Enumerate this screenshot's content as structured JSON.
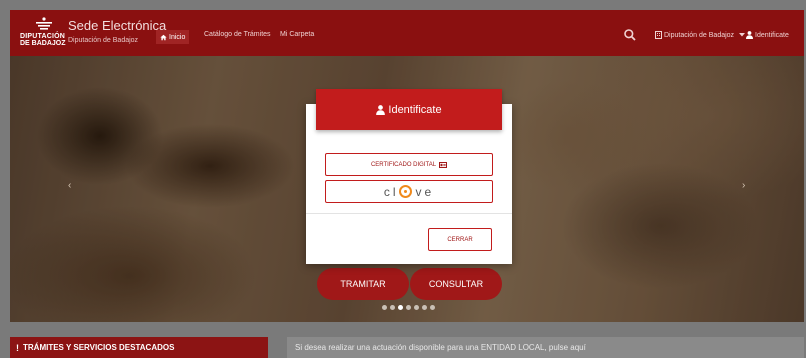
{
  "navbar": {
    "logo_line1": "DIPUTACIÓN",
    "logo_line2": "DE BADAJOZ",
    "site_title": "Sede Electrónica",
    "site_subtitle": "Diputación de Badajoz",
    "links": [
      {
        "label": "Inicio",
        "icon": "home-icon",
        "active": true
      },
      {
        "label": "Catálogo de Trámites"
      },
      {
        "label": "Mi Carpeta"
      }
    ],
    "search_icon": "search-icon",
    "org_dropdown": "Diputación de Badajoz",
    "identify": "Identificate"
  },
  "hero": {
    "prev_arrow": "‹",
    "next_arrow": "›",
    "tramitar": "TRAMITAR",
    "consultar": "CONSULTAR",
    "dots_count": 7,
    "active_dot": 2
  },
  "modal": {
    "title": "Identificate",
    "cert_label": "CERTIFICADO DIGITAL",
    "clave_label": "clave",
    "close_label": "CERRAR"
  },
  "bottom": {
    "panel_title": "TRÁMITES Y SERVICIOS DESTACADOS",
    "info_text": "Si desea realizar una actuación disponible para una ENTIDAD LOCAL, pulse aquí"
  },
  "colors": {
    "brand": "#8a1010",
    "accent": "#c21c1c",
    "clave_orange": "#f08a1c"
  }
}
